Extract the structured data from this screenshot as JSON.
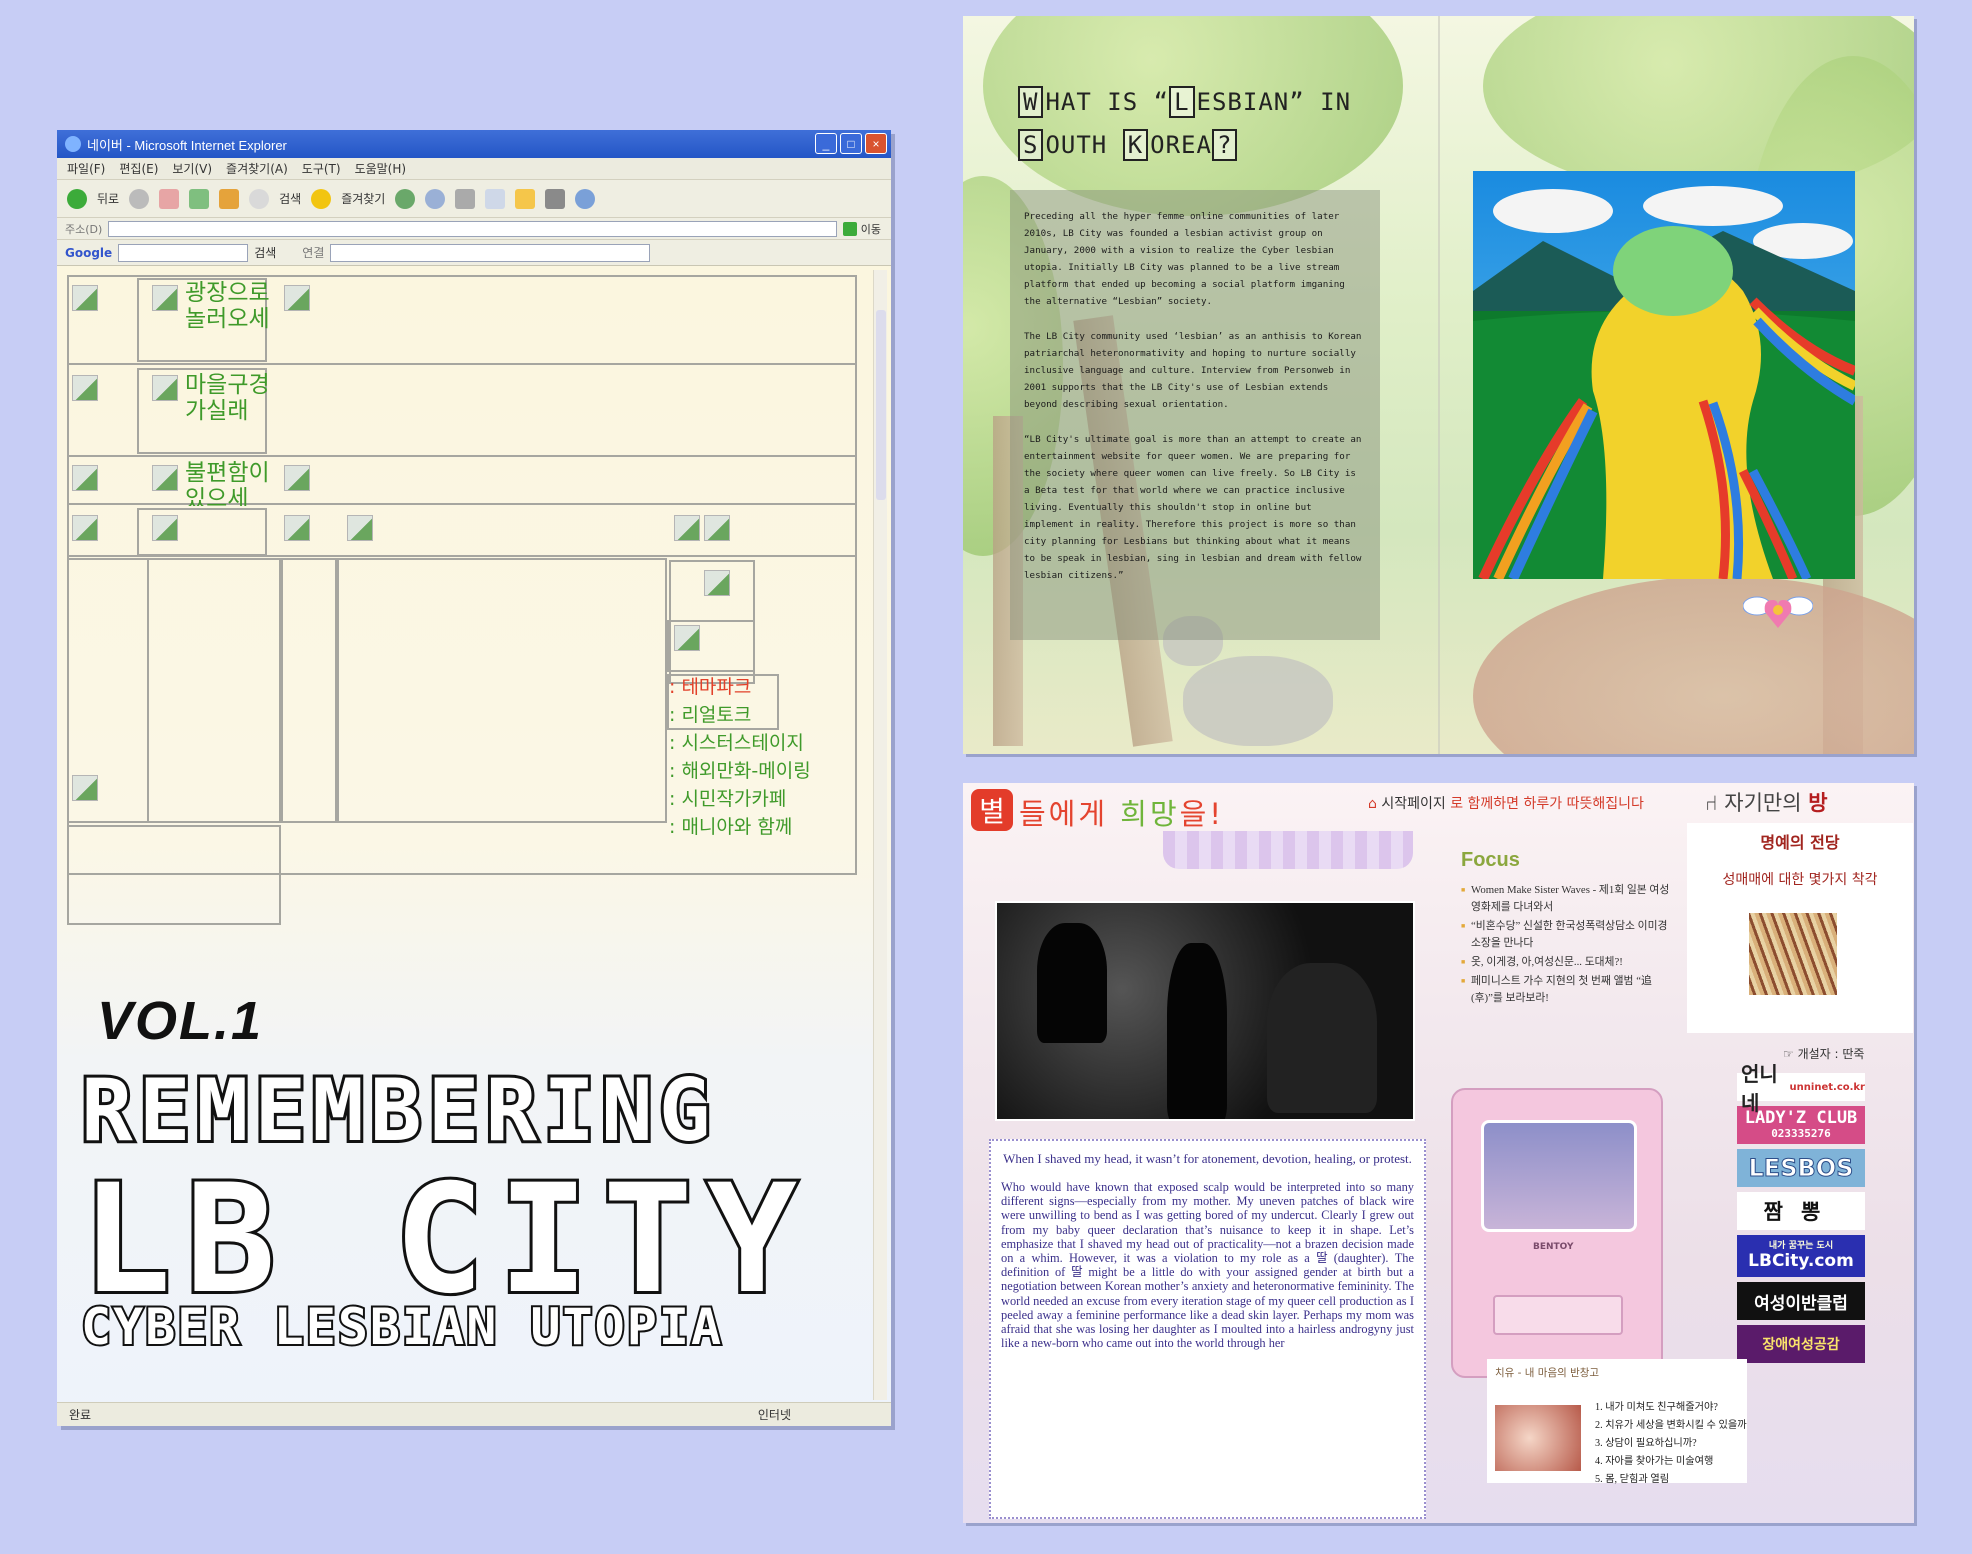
{
  "cover": {
    "ie": {
      "window_title": "네이버 - Microsoft Internet Explorer",
      "menu": [
        "파일(F)",
        "편집(E)",
        "보기(V)",
        "즐겨찾기(A)",
        "도구(T)",
        "도움말(H)"
      ],
      "toolbar": [
        "뒤로",
        "검색",
        "즐겨찾기"
      ],
      "address_label": "주소(D)",
      "go_label": "이동",
      "google_label": "Google",
      "search_label": "검색",
      "links_label": "연결",
      "status_left": "완료",
      "status_right": "인터넷"
    },
    "menu_links": [
      "광장으로 놀러오세",
      "마을구경 가실래",
      "불편함이 있으세"
    ],
    "side_links": [
      "테마파크",
      "리얼토크",
      "시스터스테이지",
      "해외만화-메이링",
      "시민작가카페",
      "매니아와 함께"
    ],
    "vol": "VOL.1",
    "title_line1": "REMEMBERING",
    "title_line2": "LB CITY",
    "title_line3": "CYBER LESBIAN UTOPIA"
  },
  "spread": {
    "heading": {
      "w": "W",
      "hat_is": "HAT IS",
      "q1": "“",
      "l": "L",
      "esbian": "ESBIAN",
      "q2": "”",
      "in": "IN",
      "s": "S",
      "outh": "OUTH",
      "k": "K",
      "orea": "OREA",
      "qm": "?"
    },
    "paragraphs": [
      "Preceding all the hyper femme online communities of later 2010s, LB City was founded a lesbian activist group on January, 2000 with a vision to realize the Cyber lesbian utopia. Initially LB City was planned to be a live stream platform that ended up becoming a social platform imganing the alternative “Lesbian” society.",
      "The LB City community used ‘lesbian’ as an anthisis to Korean patriarchal heteronormativity and hoping to nurture socially inclusive language and culture. Interview from Personweb in 2001 supports that the LB City's use of Lesbian extends beyond describing sexual orientation.",
      "“LB City's ultimate goal is more than an attempt to create an entertainment website for queer women. We are preparing for the society where queer women can live freely. So LB City is a Beta test for that world where we can practice inclusive living. Eventually this shouldn't stop in online but implement in reality. Therefore this project is more so than city planning for Lesbians but thinking about what it means to be speak in lesbian, sing in lesbian and dream with fellow lesbian citizens.”"
    ]
  },
  "collage": {
    "slogan_a": "별",
    "slogan_b": "들에게 ",
    "slogan_c": "희망",
    "slogan_d": "을!",
    "topnav_a": "시작페이지",
    "topnav_b": " 로 함께하면 하루가 따뜻해집니다",
    "room_a": "자기만의 ",
    "room_b": "방",
    "focus_title": "Focus",
    "focus_items": [
      "Women Make Sister Waves - 제1회 일본 여성영화제를 다녀와서",
      "“비혼수당” 신설한 한국성폭력상담소 이미경 소장을 만나다",
      "옷, 이게경, 아,여성신문... 도대체?!",
      "페미니스트 가수 지현의 첫 번째 앨범 “追(후)”를 보라보라!"
    ],
    "hall_title": "명예의 전당",
    "hall_subtitle": "성매매에 대한 몇가지 착각",
    "founder": "☞ 개설자 : 딴죽",
    "story_lead": "When I shaved my head, it wasn’t for atonement, devotion, healing, or protest.",
    "story_body": "Who would have known that exposed scalp would be interpreted into so many different signs—especially from my mother. My uneven patches of black wire were unwilling to bend as I was getting bored of my undercut. Clearly I grew out from my baby queer declaration that’s nuisance to keep it in shape. Let’s emphasize that I shaved my head out of practicality—not a brazen decision made on a whim. However, it was a violation to my role as a 딸 (daughter). The definition of 딸 might be a little do with your assigned gender at birth but a negotiation between Korean mother’s anxiety and heteronormative femininity. The world needed an excuse from every iteration stage of my queer cell production as I peeled away a feminine performance like a dead skin layer. Perhaps my mom was afraid that she was losing her daughter as I moulted into a hairless androgyny just like a new-born who came out into the world through her",
    "monitor_brand": "BENTOY",
    "ads": {
      "unni": "언니네",
      "unni_url": "unninet.co.kr",
      "lady": "LADY'Z CLUB",
      "lady_num": "023335276",
      "lesbos": "LESBOS",
      "jjam": "짬뽕",
      "lb_sub": "내가 꿈꾸는 도시",
      "lb": "LBCity.com",
      "yeo": "여성이반클럽",
      "jang": "장애여성공감"
    },
    "heal_header": "치유 - 내 마음의 반창고",
    "heal_items": [
      "1. 내가 미쳐도 친구해줄거야?",
      "2. 치유가 세상을 변화시킬 수 있을까",
      "3. 상담이 필요하십니까?",
      "4. 자아를 찾아가는 미술여행",
      "5. 몸, 닫힘과 열림"
    ]
  },
  "colors": {
    "background": "#c7cdf5",
    "ie_title_blue": "#2456c6",
    "link_green": "#3f9a2a",
    "link_red": "#e2412a",
    "slogan_red": "#e4442f",
    "story_ink": "#3a2f8a"
  }
}
